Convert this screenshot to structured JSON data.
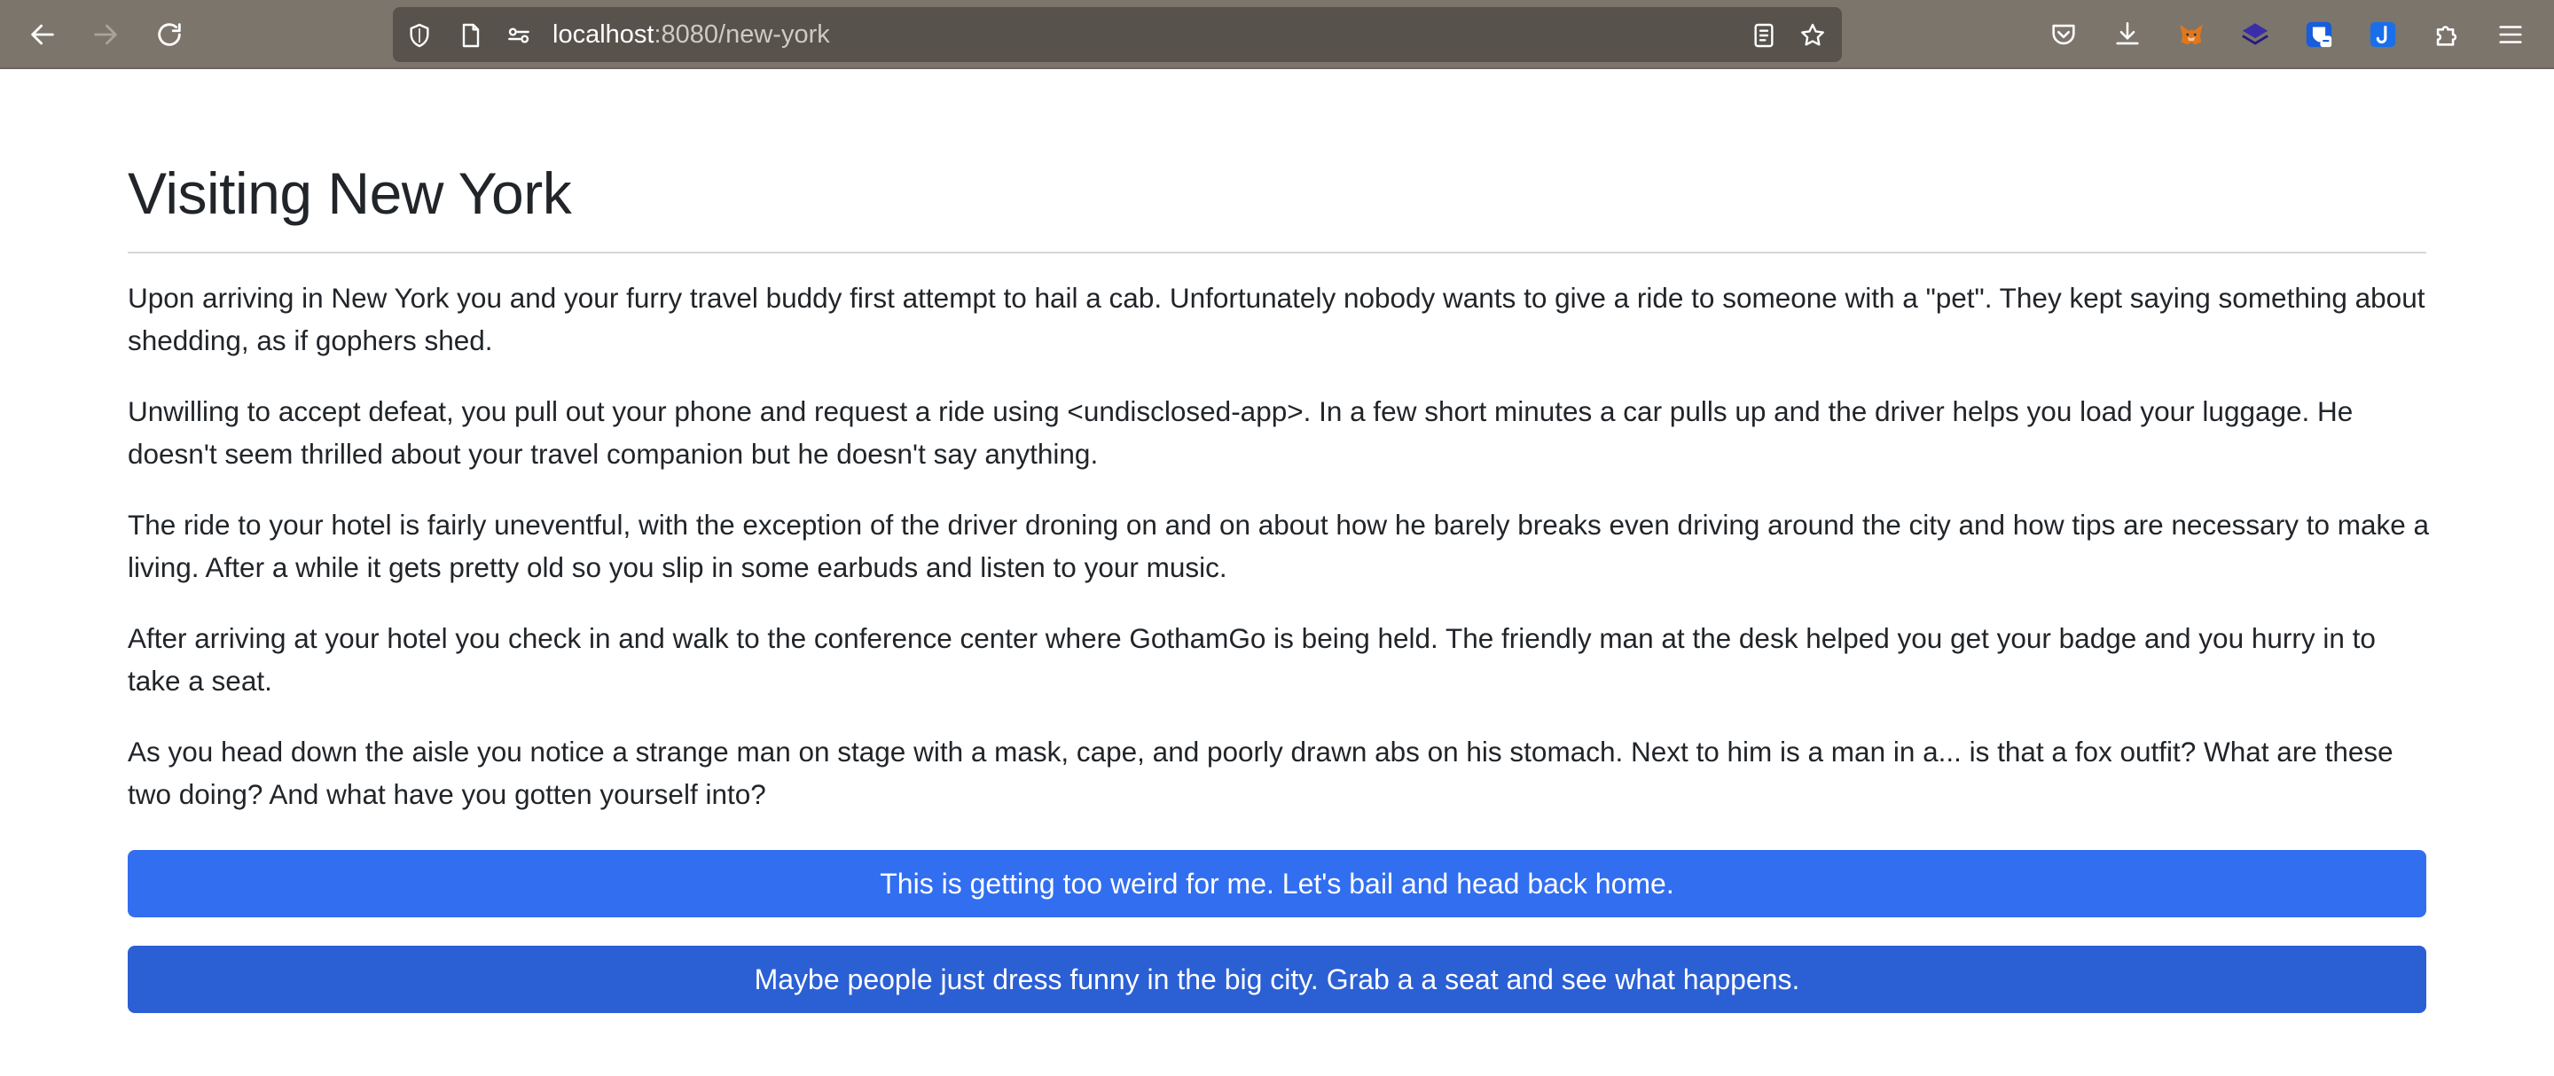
{
  "browser": {
    "url_host": "localhost",
    "url_rest": ":8080/new-york",
    "icons": [
      "back-arrow",
      "forward-arrow",
      "reload",
      "shield",
      "page",
      "site-settings",
      "reader-view",
      "bookmark-star",
      "pocket",
      "download",
      "metamask-fox",
      "layers-extension",
      "bitwarden-shield",
      "j-extension",
      "extensions-puzzle",
      "hamburger-menu"
    ]
  },
  "page": {
    "title": "Visiting New York",
    "paragraphs": [
      "Upon arriving in New York you and your furry travel buddy first attempt to hail a cab. Unfortunately nobody wants to give a ride to someone with a \"pet\". They kept saying something about shedding, as if gophers shed.",
      "Unwilling to accept defeat, you pull out your phone and request a ride using <undisclosed-app>. In a few short minutes a car pulls up and the driver helps you load your luggage. He doesn't seem thrilled about your travel companion but he doesn't say anything.",
      "The ride to your hotel is fairly uneventful, with the exception of the driver droning on and on about how he barely breaks even driving around the city and how tips are necessary to make a living. After a while it gets pretty old so you slip in some earbuds and listen to your music.",
      "After arriving at your hotel you check in and walk to the conference center where GothamGo is being held. The friendly man at the desk helped you get your badge and you hurry in to take a seat.",
      "As you head down the aisle you notice a strange man on stage with a mask, cape, and poorly drawn abs on his stomach. Next to him is a man in a... is that a fox outfit? What are these two doing? And what have you gotten yourself into?"
    ],
    "choices": [
      "This is getting too weird for me. Let's bail and head back home.",
      "Maybe people just dress funny in the big city. Grab a a seat and see what happens."
    ]
  },
  "colors": {
    "chrome_bg": "#7b756c",
    "urlbar_bg": "#57524b",
    "button_primary": "#326ef0",
    "button_secondary": "#2b5fd4",
    "text": "#212529"
  }
}
